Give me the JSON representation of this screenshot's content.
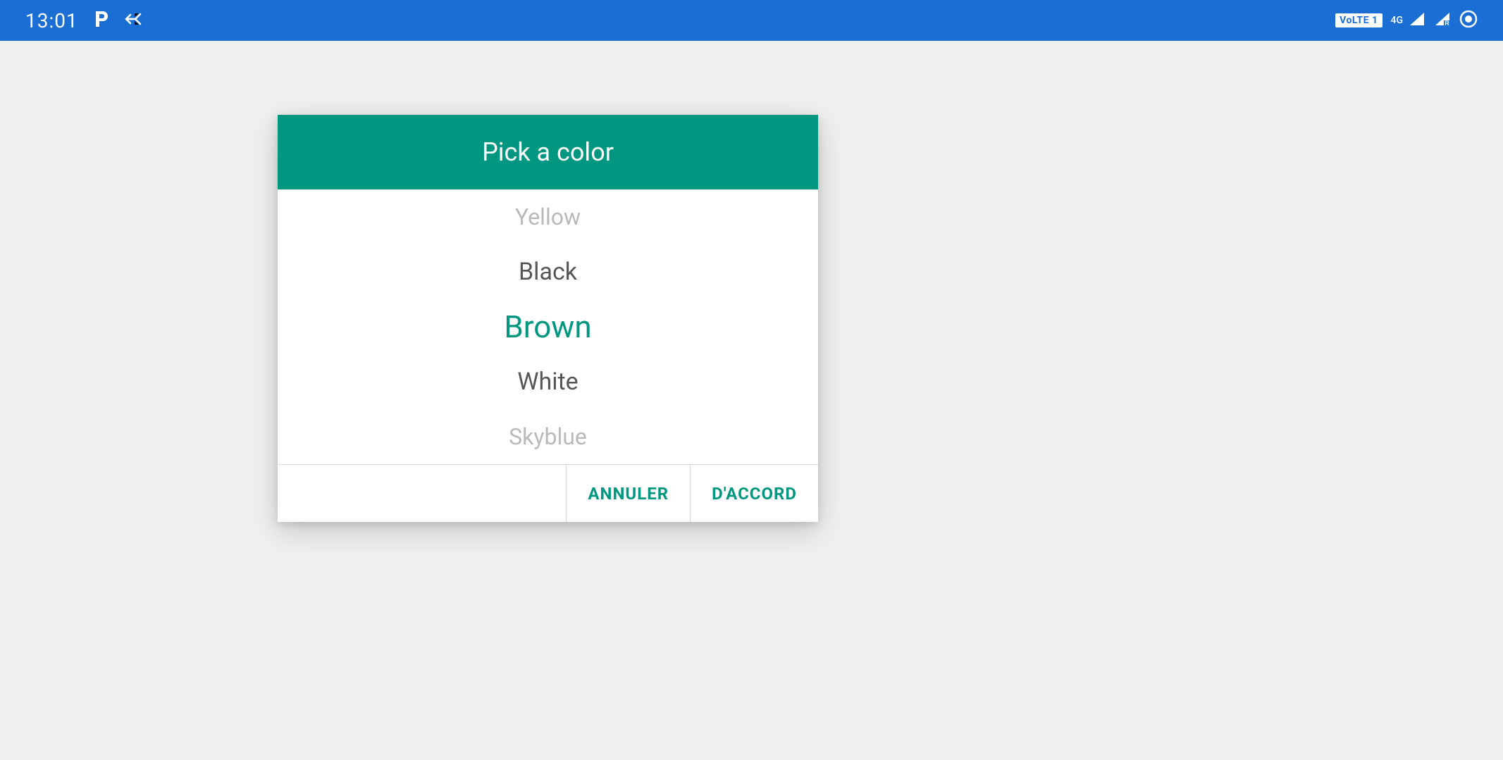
{
  "status_bar": {
    "time": "13:01",
    "volte_label": "VoLTE 1",
    "network_label": "4G"
  },
  "dialog": {
    "title": "Pick a color",
    "options": [
      "Yellow",
      "Black",
      "Brown",
      "White",
      "Skyblue"
    ],
    "selected_index": 2,
    "cancel_label": "ANNULER",
    "ok_label": "D'ACCORD"
  },
  "colors": {
    "accent": "#009780",
    "status_bar": "#1b6fd4"
  }
}
